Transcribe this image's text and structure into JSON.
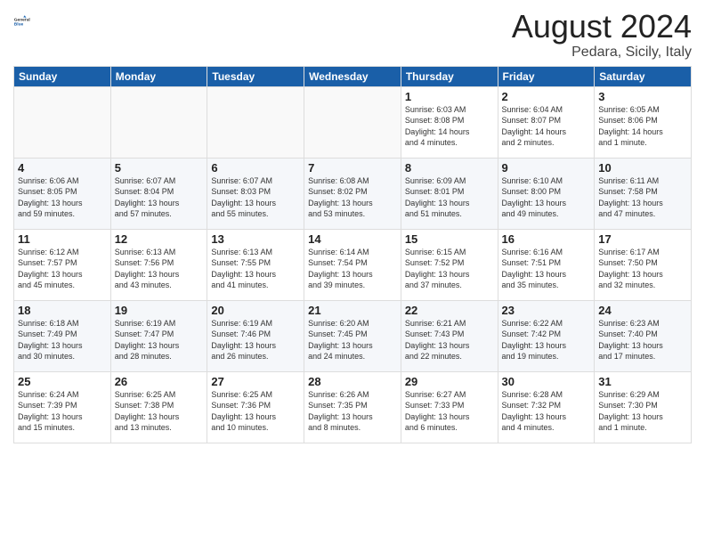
{
  "header": {
    "logo_line1": "General",
    "logo_line2": "Blue",
    "title": "August 2024",
    "location": "Pedara, Sicily, Italy"
  },
  "days_of_week": [
    "Sunday",
    "Monday",
    "Tuesday",
    "Wednesday",
    "Thursday",
    "Friday",
    "Saturday"
  ],
  "weeks": [
    [
      {
        "day": "",
        "info": ""
      },
      {
        "day": "",
        "info": ""
      },
      {
        "day": "",
        "info": ""
      },
      {
        "day": "",
        "info": ""
      },
      {
        "day": "1",
        "info": "Sunrise: 6:03 AM\nSunset: 8:08 PM\nDaylight: 14 hours\nand 4 minutes."
      },
      {
        "day": "2",
        "info": "Sunrise: 6:04 AM\nSunset: 8:07 PM\nDaylight: 14 hours\nand 2 minutes."
      },
      {
        "day": "3",
        "info": "Sunrise: 6:05 AM\nSunset: 8:06 PM\nDaylight: 14 hours\nand 1 minute."
      }
    ],
    [
      {
        "day": "4",
        "info": "Sunrise: 6:06 AM\nSunset: 8:05 PM\nDaylight: 13 hours\nand 59 minutes."
      },
      {
        "day": "5",
        "info": "Sunrise: 6:07 AM\nSunset: 8:04 PM\nDaylight: 13 hours\nand 57 minutes."
      },
      {
        "day": "6",
        "info": "Sunrise: 6:07 AM\nSunset: 8:03 PM\nDaylight: 13 hours\nand 55 minutes."
      },
      {
        "day": "7",
        "info": "Sunrise: 6:08 AM\nSunset: 8:02 PM\nDaylight: 13 hours\nand 53 minutes."
      },
      {
        "day": "8",
        "info": "Sunrise: 6:09 AM\nSunset: 8:01 PM\nDaylight: 13 hours\nand 51 minutes."
      },
      {
        "day": "9",
        "info": "Sunrise: 6:10 AM\nSunset: 8:00 PM\nDaylight: 13 hours\nand 49 minutes."
      },
      {
        "day": "10",
        "info": "Sunrise: 6:11 AM\nSunset: 7:58 PM\nDaylight: 13 hours\nand 47 minutes."
      }
    ],
    [
      {
        "day": "11",
        "info": "Sunrise: 6:12 AM\nSunset: 7:57 PM\nDaylight: 13 hours\nand 45 minutes."
      },
      {
        "day": "12",
        "info": "Sunrise: 6:13 AM\nSunset: 7:56 PM\nDaylight: 13 hours\nand 43 minutes."
      },
      {
        "day": "13",
        "info": "Sunrise: 6:13 AM\nSunset: 7:55 PM\nDaylight: 13 hours\nand 41 minutes."
      },
      {
        "day": "14",
        "info": "Sunrise: 6:14 AM\nSunset: 7:54 PM\nDaylight: 13 hours\nand 39 minutes."
      },
      {
        "day": "15",
        "info": "Sunrise: 6:15 AM\nSunset: 7:52 PM\nDaylight: 13 hours\nand 37 minutes."
      },
      {
        "day": "16",
        "info": "Sunrise: 6:16 AM\nSunset: 7:51 PM\nDaylight: 13 hours\nand 35 minutes."
      },
      {
        "day": "17",
        "info": "Sunrise: 6:17 AM\nSunset: 7:50 PM\nDaylight: 13 hours\nand 32 minutes."
      }
    ],
    [
      {
        "day": "18",
        "info": "Sunrise: 6:18 AM\nSunset: 7:49 PM\nDaylight: 13 hours\nand 30 minutes."
      },
      {
        "day": "19",
        "info": "Sunrise: 6:19 AM\nSunset: 7:47 PM\nDaylight: 13 hours\nand 28 minutes."
      },
      {
        "day": "20",
        "info": "Sunrise: 6:19 AM\nSunset: 7:46 PM\nDaylight: 13 hours\nand 26 minutes."
      },
      {
        "day": "21",
        "info": "Sunrise: 6:20 AM\nSunset: 7:45 PM\nDaylight: 13 hours\nand 24 minutes."
      },
      {
        "day": "22",
        "info": "Sunrise: 6:21 AM\nSunset: 7:43 PM\nDaylight: 13 hours\nand 22 minutes."
      },
      {
        "day": "23",
        "info": "Sunrise: 6:22 AM\nSunset: 7:42 PM\nDaylight: 13 hours\nand 19 minutes."
      },
      {
        "day": "24",
        "info": "Sunrise: 6:23 AM\nSunset: 7:40 PM\nDaylight: 13 hours\nand 17 minutes."
      }
    ],
    [
      {
        "day": "25",
        "info": "Sunrise: 6:24 AM\nSunset: 7:39 PM\nDaylight: 13 hours\nand 15 minutes."
      },
      {
        "day": "26",
        "info": "Sunrise: 6:25 AM\nSunset: 7:38 PM\nDaylight: 13 hours\nand 13 minutes."
      },
      {
        "day": "27",
        "info": "Sunrise: 6:25 AM\nSunset: 7:36 PM\nDaylight: 13 hours\nand 10 minutes."
      },
      {
        "day": "28",
        "info": "Sunrise: 6:26 AM\nSunset: 7:35 PM\nDaylight: 13 hours\nand 8 minutes."
      },
      {
        "day": "29",
        "info": "Sunrise: 6:27 AM\nSunset: 7:33 PM\nDaylight: 13 hours\nand 6 minutes."
      },
      {
        "day": "30",
        "info": "Sunrise: 6:28 AM\nSunset: 7:32 PM\nDaylight: 13 hours\nand 4 minutes."
      },
      {
        "day": "31",
        "info": "Sunrise: 6:29 AM\nSunset: 7:30 PM\nDaylight: 13 hours\nand 1 minute."
      }
    ]
  ]
}
